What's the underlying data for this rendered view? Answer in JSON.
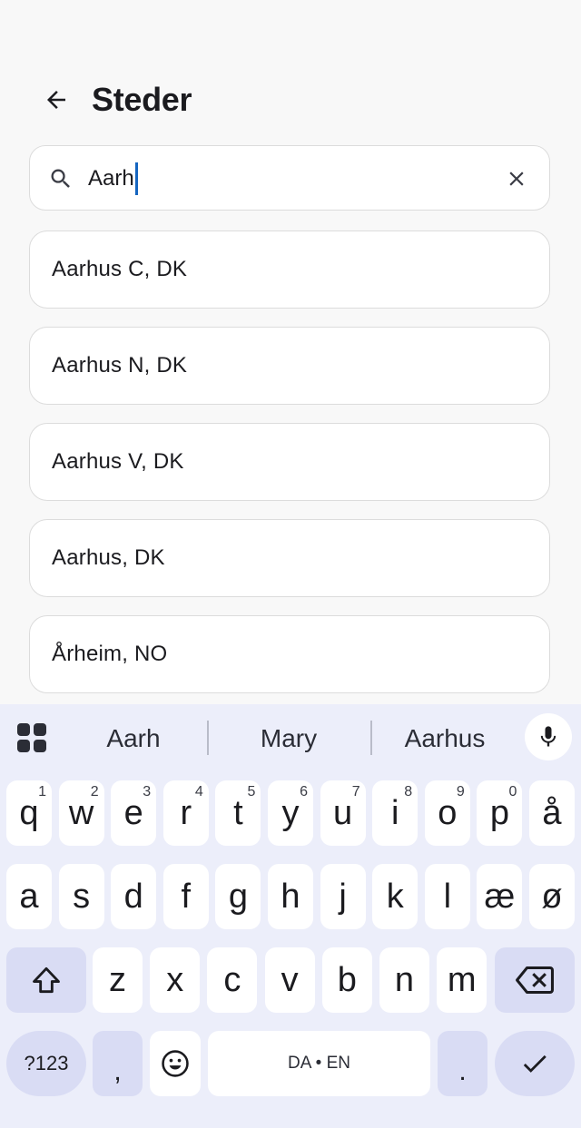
{
  "header": {
    "title": "Steder",
    "back_icon": "arrow-left-icon"
  },
  "search": {
    "value": "Aarh",
    "search_icon": "search-icon",
    "clear_icon": "close-icon"
  },
  "results": [
    "Aarhus C, DK",
    "Aarhus N, DK",
    "Aarhus V, DK",
    "Aarhus, DK",
    "Årheim, NO"
  ],
  "keyboard": {
    "suggestions": [
      "Aarh",
      "Mary",
      "Aarhus"
    ],
    "row1": [
      "q",
      "w",
      "e",
      "r",
      "t",
      "y",
      "u",
      "i",
      "o",
      "p",
      "å"
    ],
    "row1_hints": [
      "1",
      "2",
      "3",
      "4",
      "5",
      "6",
      "7",
      "8",
      "9",
      "0",
      ""
    ],
    "row2": [
      "a",
      "s",
      "d",
      "f",
      "g",
      "h",
      "j",
      "k",
      "l",
      "æ",
      "ø"
    ],
    "row3": [
      "z",
      "x",
      "c",
      "v",
      "b",
      "n",
      "m"
    ],
    "symbols_label": "?123",
    "comma_label": ",",
    "space_label": "DA • EN",
    "period_label": ".",
    "colors": {
      "background": "#eceefa",
      "key": "#ffffff",
      "modifier_key": "#d9dcf4"
    }
  }
}
